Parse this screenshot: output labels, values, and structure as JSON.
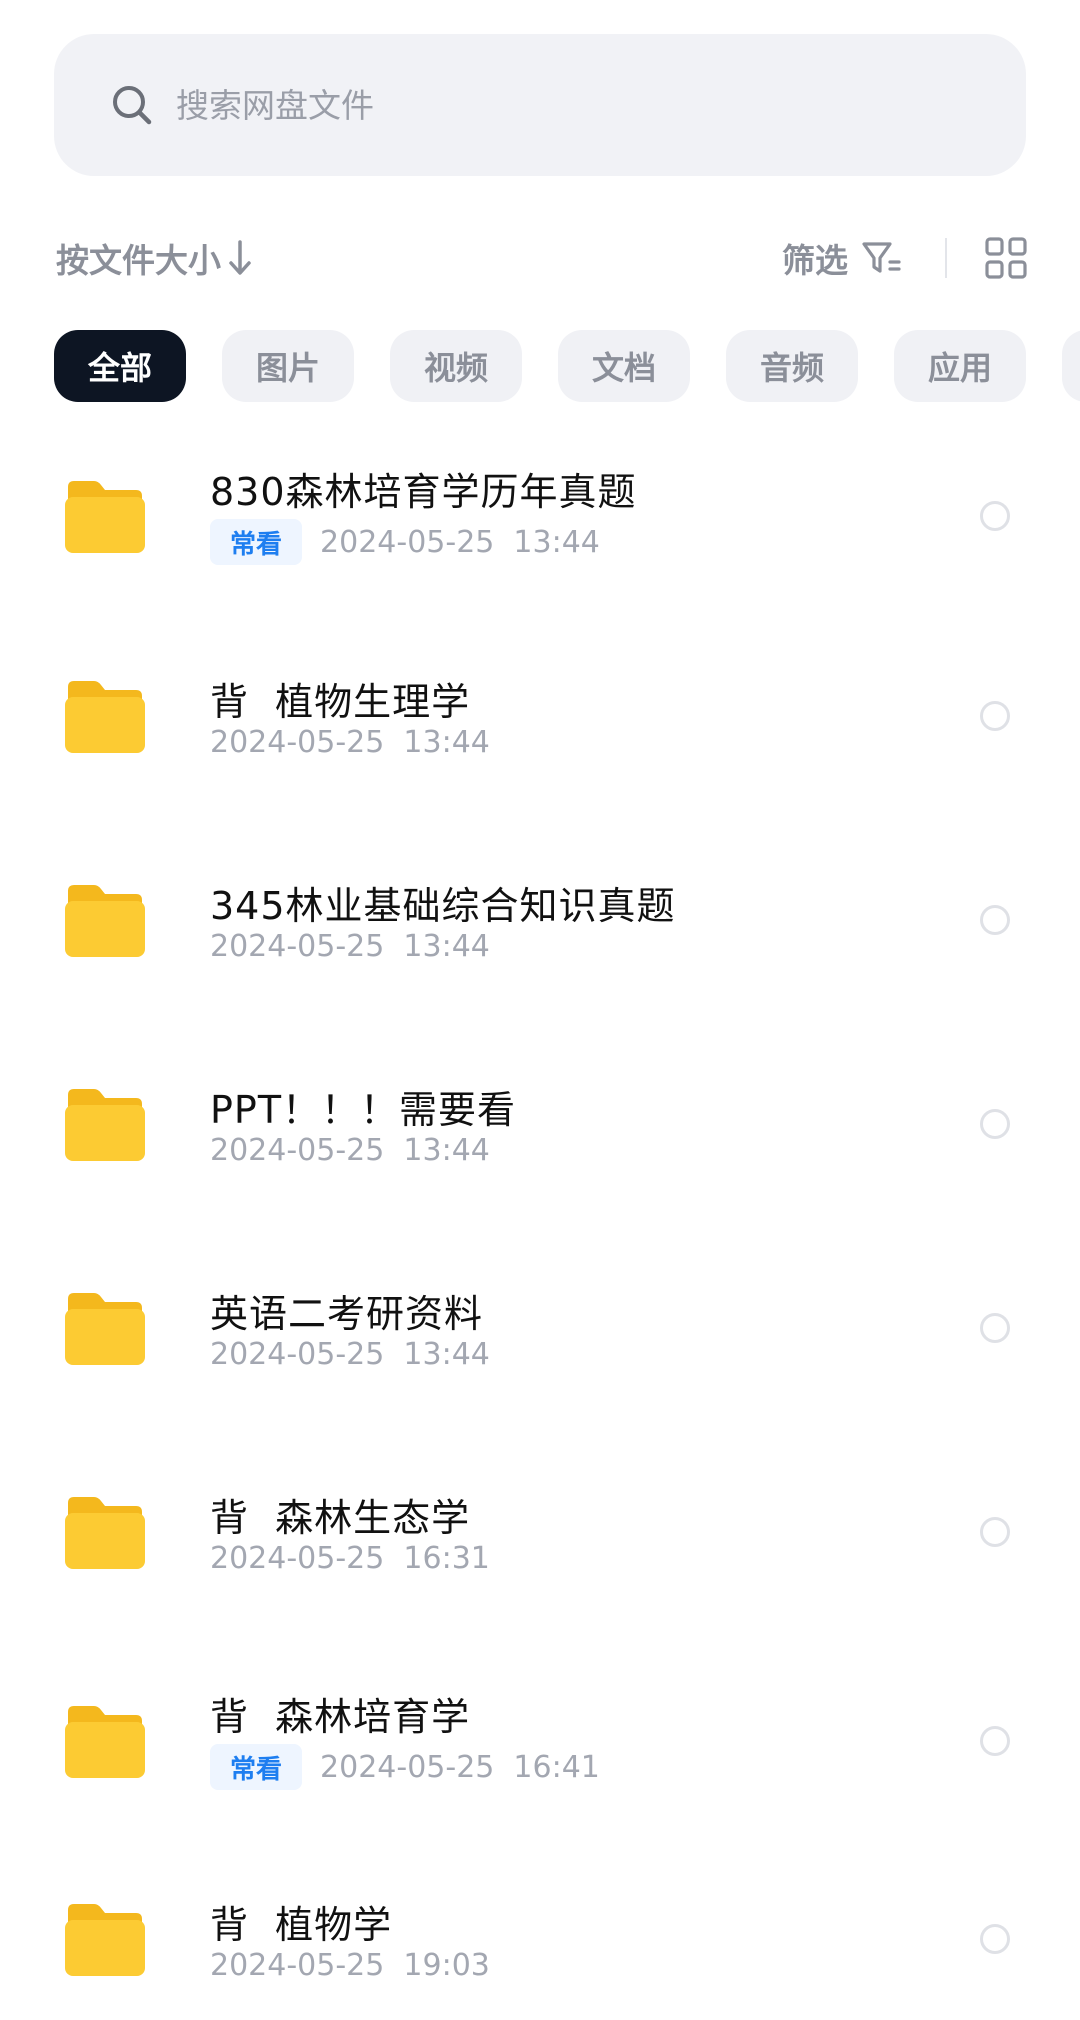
{
  "search": {
    "placeholder": "搜索网盘文件"
  },
  "toolbar": {
    "sort_label": "按文件大小",
    "filter_label": "筛选"
  },
  "chips": [
    {
      "label": "全部",
      "active": true
    },
    {
      "label": "图片",
      "active": false
    },
    {
      "label": "视频",
      "active": false
    },
    {
      "label": "文档",
      "active": false
    },
    {
      "label": "音频",
      "active": false
    },
    {
      "label": "应用",
      "active": false
    }
  ],
  "files": [
    {
      "name": "830森林培育学历年真题",
      "tag": "常看",
      "date": "2024-05-25  13:44"
    },
    {
      "name": "背  植物生理学",
      "tag": "",
      "date": "2024-05-25  13:44"
    },
    {
      "name": "345林业基础综合知识真题",
      "tag": "",
      "date": "2024-05-25  13:44"
    },
    {
      "name": "PPT！！！需要看",
      "tag": "",
      "date": "2024-05-25  13:44"
    },
    {
      "name": "英语二考研资料",
      "tag": "",
      "date": "2024-05-25  13:44"
    },
    {
      "name": "背  森林生态学",
      "tag": "",
      "date": "2024-05-25  16:31"
    },
    {
      "name": "背  森林培育学",
      "tag": "常看",
      "date": "2024-05-25  16:41"
    },
    {
      "name": "背  植物学",
      "tag": "",
      "date": "2024-05-25  19:03"
    }
  ],
  "colors": {
    "accent_dark": "#0d1523",
    "tag_blue": "#1e7ef0",
    "folder_yellow": "#fbc82c"
  },
  "icons": {
    "search": "search-icon",
    "sort": "arrow-down-icon",
    "filter": "filter-icon",
    "view": "grid-view-icon",
    "folder": "folder-icon",
    "select": "radio-icon"
  }
}
